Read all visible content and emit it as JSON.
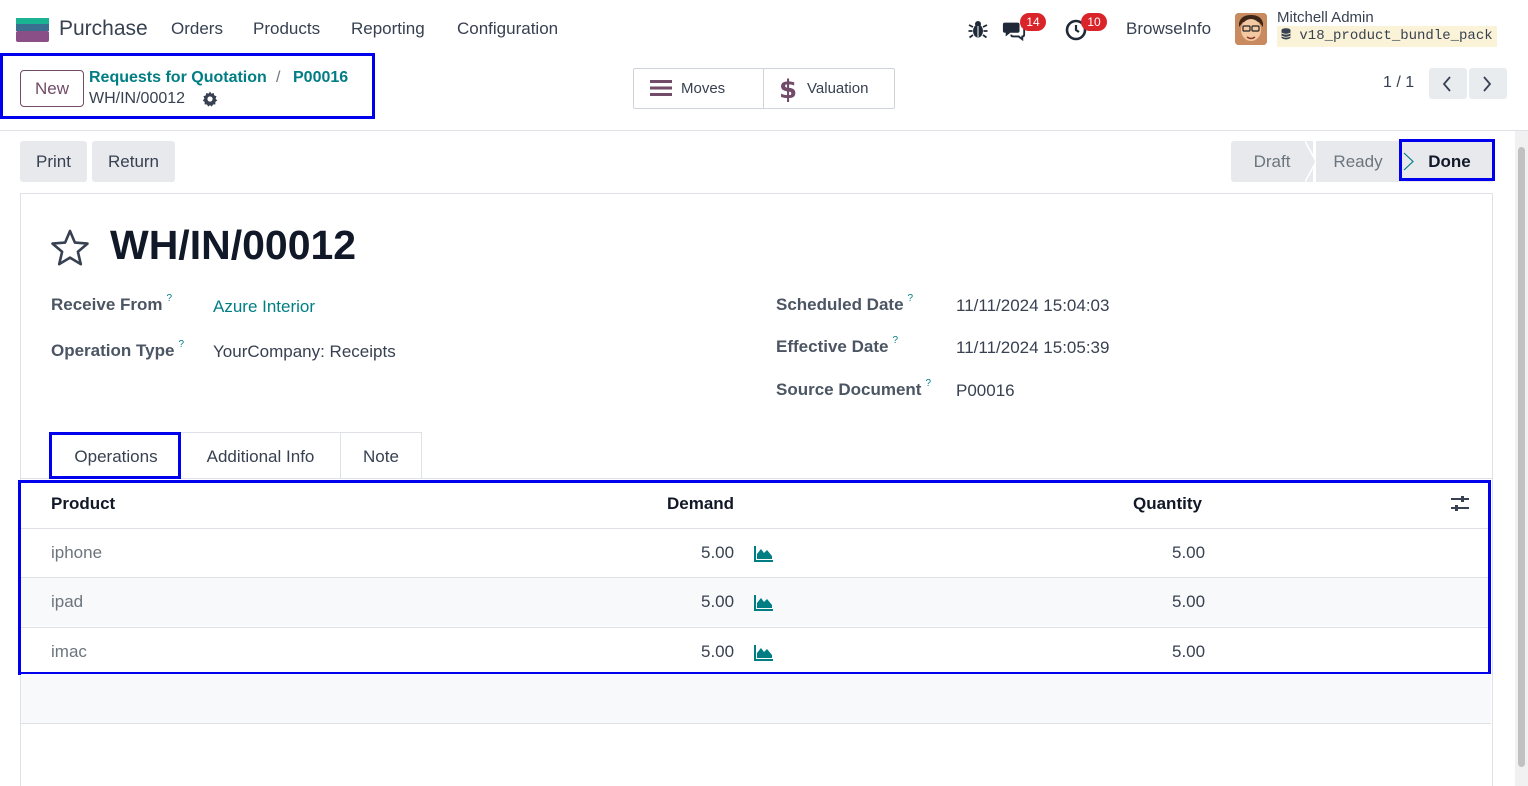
{
  "navbar": {
    "app_name": "Purchase",
    "menu": [
      "Orders",
      "Products",
      "Reporting",
      "Configuration"
    ],
    "messages_count": "14",
    "activities_count": "10",
    "company": "BrowseInfo",
    "user_name": "Mitchell Admin",
    "database": "v18_product_bundle_pack"
  },
  "control": {
    "new_label": "New",
    "breadcrumb": [
      "Requests for Quotation",
      "P00016"
    ],
    "breadcrumb_separator": "/",
    "current_record": "WH/IN/00012",
    "smart_buttons": {
      "moves": "Moves",
      "valuation": "Valuation"
    },
    "pager": "1 / 1"
  },
  "statusbar": {
    "actions": {
      "print": "Print",
      "return": "Return"
    },
    "stages": [
      "Draft",
      "Ready",
      "Done"
    ],
    "active_stage": "Done"
  },
  "form": {
    "title": "WH/IN/00012",
    "tooltip_marker": "?",
    "receive_from_label": "Receive From",
    "receive_from_value": "Azure Interior",
    "operation_type_label": "Operation Type",
    "operation_type_value": "YourCompany: Receipts",
    "scheduled_date_label": "Scheduled Date",
    "scheduled_date_value": "11/11/2024 15:04:03",
    "effective_date_label": "Effective Date",
    "effective_date_value": "11/11/2024 15:05:39",
    "source_document_label": "Source Document",
    "source_document_value": "P00016"
  },
  "tabs": [
    "Operations",
    "Additional Info",
    "Note"
  ],
  "table": {
    "headers": {
      "product": "Product",
      "demand": "Demand",
      "quantity": "Quantity"
    },
    "rows": [
      {
        "product": "iphone",
        "demand": "5.00",
        "quantity": "5.00"
      },
      {
        "product": "ipad",
        "demand": "5.00",
        "quantity": "5.00"
      },
      {
        "product": "imac",
        "demand": "5.00",
        "quantity": "5.00"
      }
    ]
  },
  "colors": {
    "brand": "#714b67",
    "link": "#017e84",
    "highlight": "#0000ee",
    "badge": "#d9242a"
  }
}
